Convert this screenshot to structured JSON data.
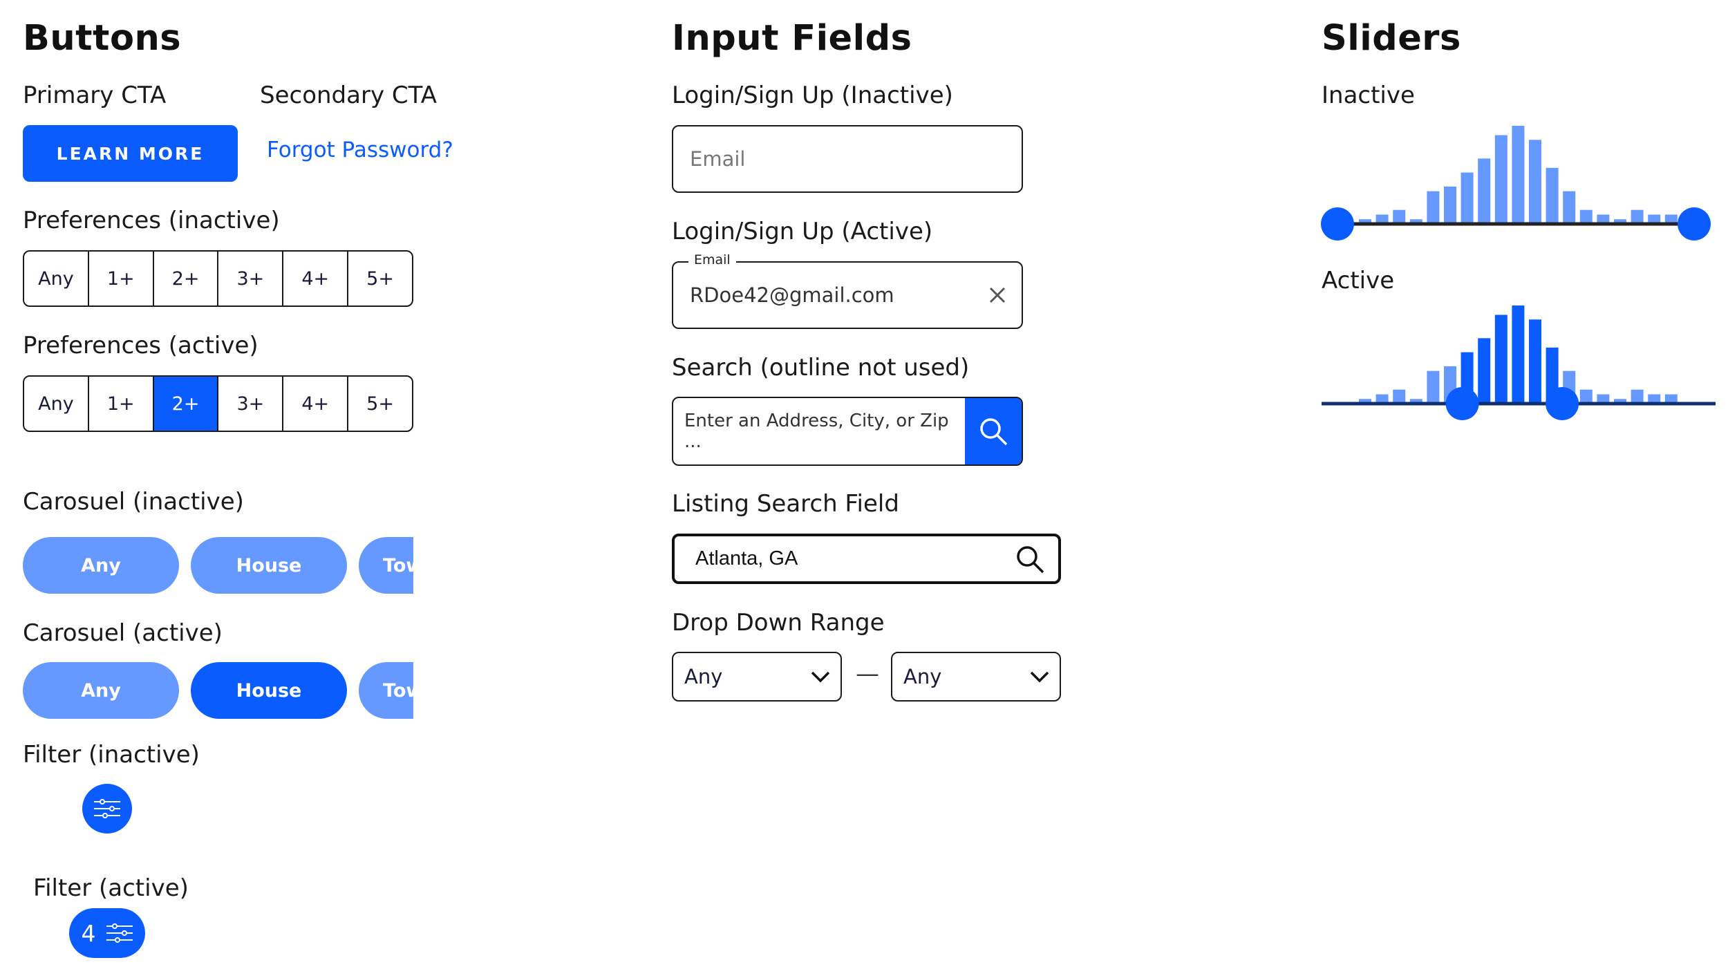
{
  "colors": {
    "primary": "#0a5cff",
    "light": "#6699ff",
    "slider_track_inactive": "#222222",
    "slider_track_active": "#0f2e6e"
  },
  "buttons": {
    "heading": "Buttons",
    "primary_cta_label": "Primary CTA",
    "primary_cta_button": "LEARN MORE",
    "secondary_cta_label": "Secondary CTA",
    "secondary_cta_link": "Forgot Password?",
    "preferences_inactive": {
      "label": "Preferences (inactive)",
      "options": [
        "Any",
        "1+",
        "2+",
        "3+",
        "4+",
        "5+"
      ]
    },
    "preferences_active": {
      "label": "Preferences (active)",
      "options": [
        "Any",
        "1+",
        "2+",
        "3+",
        "4+",
        "5+"
      ],
      "selected": "2+"
    },
    "carousel_inactive": {
      "label": "Carosuel (inactive)",
      "items": [
        "Any",
        "House",
        "Townhouse"
      ]
    },
    "carousel_active": {
      "label": "Carosuel (active)",
      "items": [
        "Any",
        "House",
        "Townhouse"
      ],
      "selected": "House"
    },
    "filter_inactive": {
      "label": "Filter (inactive)",
      "icon": "sliders-icon"
    },
    "filter_active": {
      "label": "Filter (active)",
      "count": "4",
      "icon": "sliders-icon"
    }
  },
  "inputs": {
    "heading": "Input Fields",
    "login_inactive": {
      "label": "Login/Sign Up (Inactive)",
      "placeholder": "Email"
    },
    "login_active": {
      "label": "Login/Sign Up (Active)",
      "float_label": "Email",
      "value": "RDoe42@gmail.com",
      "clear_icon": "close-icon"
    },
    "search": {
      "label": "Search (outline not used)",
      "placeholder": "Enter an Address, City, or Zip ...",
      "icon": "search-icon"
    },
    "listing": {
      "label": "Listing Search Field",
      "value": "Atlanta, GA",
      "icon": "search-icon"
    },
    "dropdown": {
      "label": "Drop Down Range",
      "min": "Any",
      "max": "Any",
      "separator": "—",
      "icon": "chevron-down-icon"
    }
  },
  "sliders": {
    "heading": "Sliders",
    "inactive": {
      "label": "Inactive",
      "histogram": [
        1,
        2,
        3,
        1,
        7,
        8,
        11,
        14,
        19,
        21,
        18,
        12,
        7,
        3,
        2,
        1,
        3,
        2,
        2
      ],
      "range": [
        0,
        1
      ]
    },
    "active": {
      "label": "Active",
      "histogram": [
        1,
        2,
        3,
        1,
        7,
        8,
        11,
        14,
        19,
        21,
        18,
        12,
        7,
        3,
        2,
        1,
        3,
        2,
        2
      ],
      "range": [
        0.35,
        0.63
      ]
    }
  }
}
